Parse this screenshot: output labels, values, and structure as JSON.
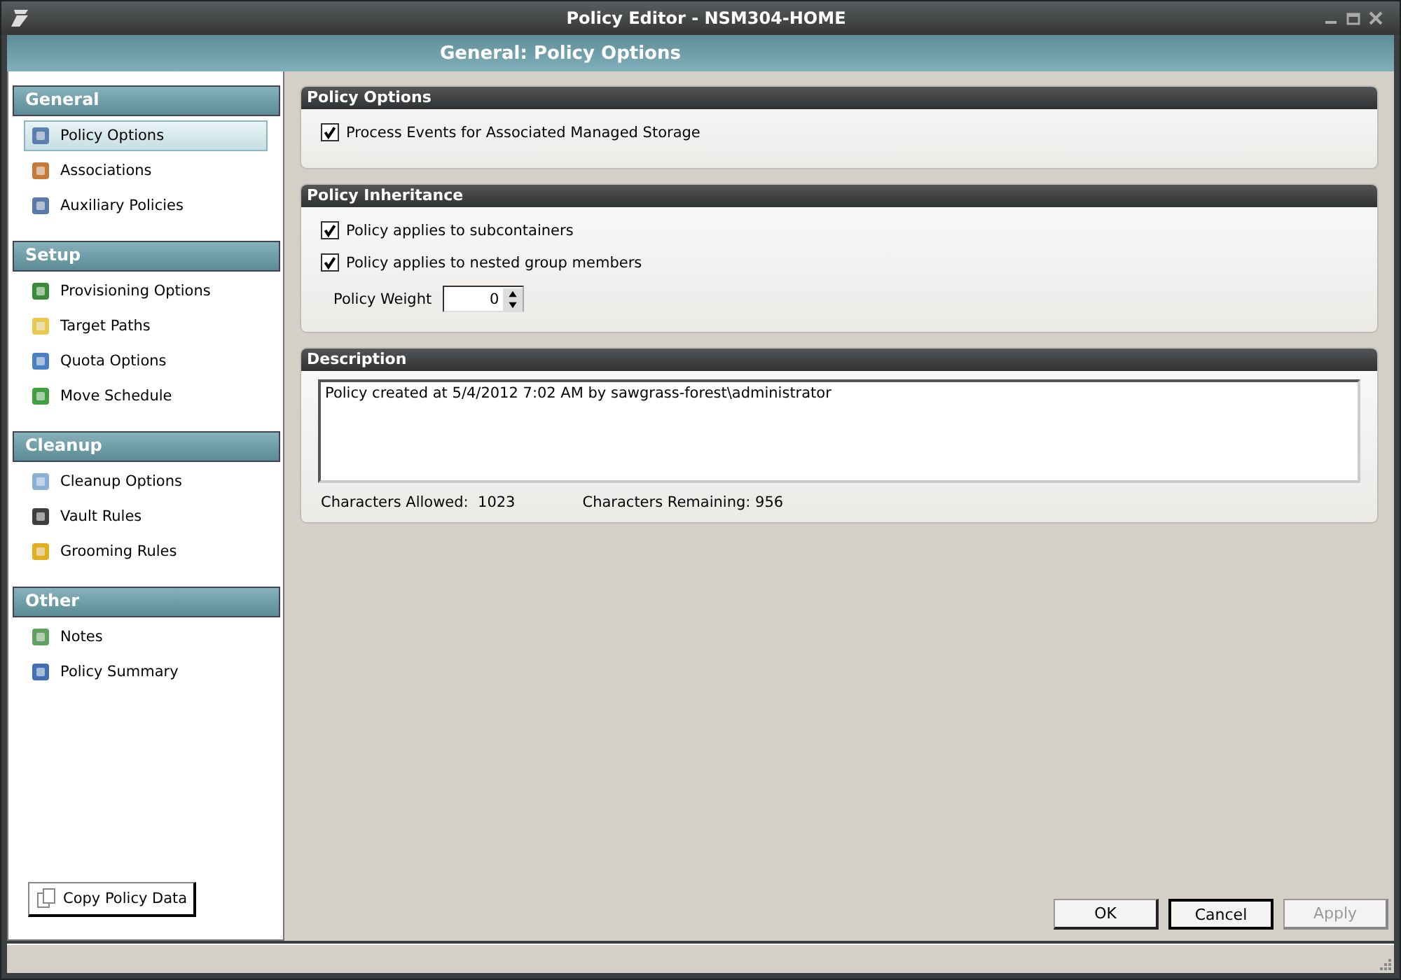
{
  "window": {
    "title": "Policy Editor - NSM304-HOME"
  },
  "header": {
    "title": "General: Policy Options"
  },
  "sidebar": {
    "sections": [
      {
        "title": "General",
        "items": [
          {
            "label": "Policy Options",
            "selected": true
          },
          {
            "label": "Associations",
            "selected": false
          },
          {
            "label": "Auxiliary Policies",
            "selected": false
          }
        ]
      },
      {
        "title": "Setup",
        "items": [
          {
            "label": "Provisioning Options",
            "selected": false
          },
          {
            "label": "Target Paths",
            "selected": false
          },
          {
            "label": "Quota Options",
            "selected": false
          },
          {
            "label": "Move Schedule",
            "selected": false
          }
        ]
      },
      {
        "title": "Cleanup",
        "items": [
          {
            "label": "Cleanup Options",
            "selected": false
          },
          {
            "label": "Vault Rules",
            "selected": false
          },
          {
            "label": "Grooming Rules",
            "selected": false
          }
        ]
      },
      {
        "title": "Other",
        "items": [
          {
            "label": "Notes",
            "selected": false
          },
          {
            "label": "Policy Summary",
            "selected": false
          }
        ]
      }
    ],
    "copy_button": "Copy Policy Data"
  },
  "policy_options": {
    "title": "Policy Options",
    "checkboxes": [
      {
        "label": "Process Events for Associated Managed Storage",
        "checked": true
      }
    ]
  },
  "policy_inheritance": {
    "title": "Policy Inheritance",
    "checkboxes": [
      {
        "label": "Policy applies to subcontainers",
        "checked": true
      },
      {
        "label": "Policy applies to nested group members",
        "checked": true
      }
    ],
    "weight_label": "Policy Weight",
    "weight_value": "0"
  },
  "description": {
    "title": "Description",
    "text": "Policy created at 5/4/2012 7:02 AM by sawgrass-forest\\administrator",
    "allowed_label": "Characters Allowed:",
    "allowed_value": "1023",
    "remaining_label": "Characters Remaining:",
    "remaining_value": "956"
  },
  "buttons": [
    {
      "label": "OK",
      "disabled": false,
      "focused": false
    },
    {
      "label": "Cancel",
      "disabled": false,
      "focused": true
    },
    {
      "label": "Apply",
      "disabled": true,
      "focused": false
    }
  ]
}
